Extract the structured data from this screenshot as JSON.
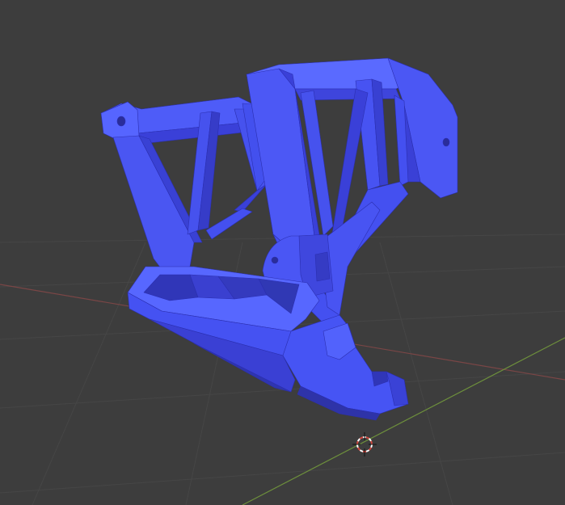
{
  "viewport": {
    "background": "#3d3d3d",
    "grid_color": "#474747",
    "x_axis_color": "#8b4b4b",
    "y_axis_color": "#6d8f3c"
  },
  "object": {
    "color_top": "#5b6bff",
    "color_mid": "#4450f0",
    "color_side": "#3a3fd6",
    "color_dark": "#2e31b8"
  },
  "cursor": {
    "icon": "3d-cursor-icon",
    "ring_colors": [
      "#ffffff",
      "#d2473e"
    ]
  }
}
